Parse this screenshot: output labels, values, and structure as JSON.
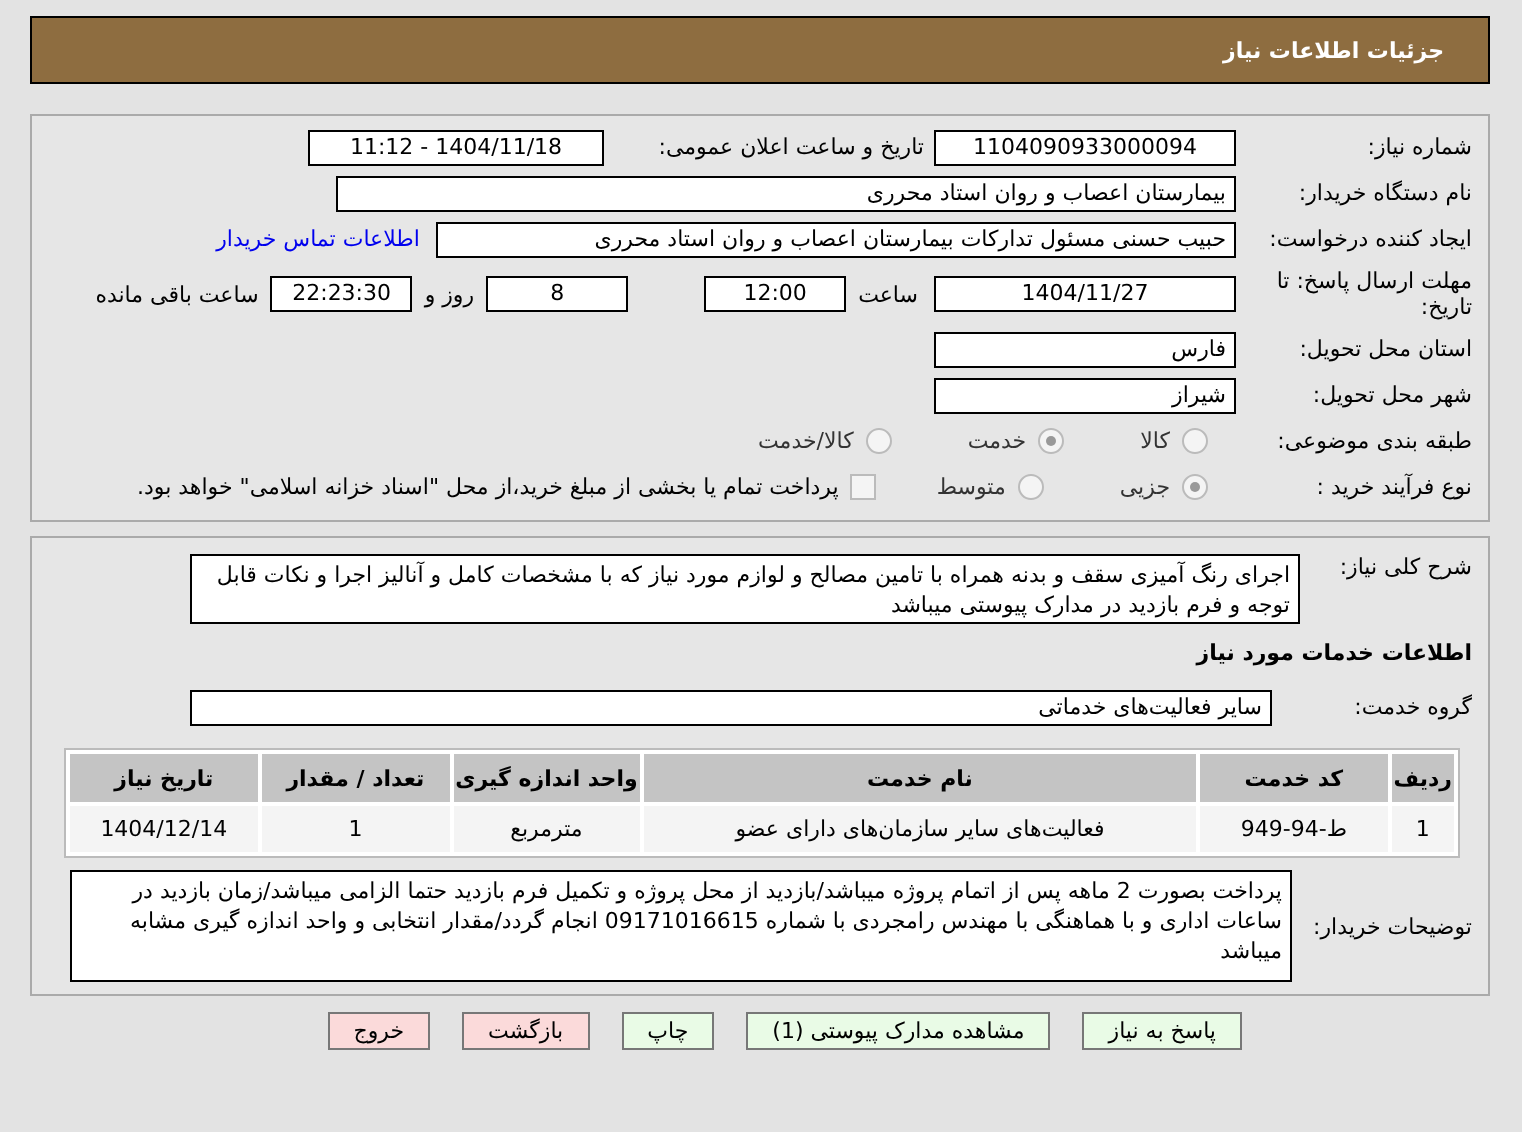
{
  "header": {
    "title": "جزئیات اطلاعات نیاز"
  },
  "need_info": {
    "need_number": {
      "label": "شماره نیاز:",
      "value": "1104090933000094"
    },
    "announce_datetime": {
      "label": "تاریخ و ساعت اعلان عمومی:",
      "value": "1404/11/18 - 11:12"
    },
    "buyer_org": {
      "label": "نام دستگاه خریدار:",
      "value": "بیمارستان اعصاب و روان استاد محرری"
    },
    "requester": {
      "label": "ایجاد کننده درخواست:",
      "value": "حبیب حسنی مسئول تدارکات بیمارستان اعصاب و روان استاد محرری"
    },
    "contact_link": "اطلاعات تماس خریدار",
    "deadline": {
      "label": "مهلت ارسال پاسخ: تا تاریخ:",
      "date": "1404/11/27",
      "time_label": "ساعت",
      "time": "12:00",
      "days": "8",
      "days_label": "روز و",
      "remaining": "22:23:30",
      "remaining_label": "ساعت باقی مانده"
    },
    "province": {
      "label": "استان محل تحویل:",
      "value": "فارس"
    },
    "city": {
      "label": "شهر محل تحویل:",
      "value": "شیراز"
    },
    "category": {
      "label": "طبقه بندی موضوعی:",
      "options": [
        {
          "label": "کالا",
          "selected": false
        },
        {
          "label": "خدمت",
          "selected": true
        },
        {
          "label": "کالا/خدمت",
          "selected": false
        }
      ]
    },
    "purchase_type": {
      "label": "نوع فرآیند خرید :",
      "options": [
        {
          "label": "جزیی",
          "selected": true
        },
        {
          "label": "متوسط",
          "selected": false
        }
      ],
      "treasury_payment": {
        "checked": false,
        "text": "پرداخت تمام یا بخشی از مبلغ خرید،از محل \"اسناد خزانه اسلامی\" خواهد بود."
      }
    }
  },
  "details": {
    "description": {
      "label": "شرح کلی نیاز:",
      "value": "اجرای رنگ آمیزی سقف و بدنه همراه با تامین مصالح و لوازم مورد نیاز که با مشخصات کامل و آنالیز اجرا و نکات قابل توجه و فرم بازدید در مدارک پیوستی میباشد"
    },
    "services_heading": "اطلاعات خدمات مورد نیاز",
    "service_group": {
      "label": "گروه خدمت:",
      "value": "سایر فعالیت‌های خدماتی"
    },
    "table": {
      "columns": [
        "ردیف",
        "کد خدمت",
        "نام خدمت",
        "واحد اندازه گیری",
        "تعداد / مقدار",
        "تاریخ نیاز"
      ],
      "rows": [
        [
          "1",
          "ط-94-949",
          "فعالیت‌های سایر سازمان‌های دارای عضو",
          "مترمربع",
          "1",
          "1404/12/14"
        ]
      ]
    },
    "buyer_notes": {
      "label": "توضیحات خریدار:",
      "value": "پرداخت بصورت 2 ماهه پس از اتمام پروژه میباشد/بازدید از محل پروژه و تکمیل فرم بازدید حتما الزامی میباشد/زمان بازدید در ساعات اداری و با هماهنگی با مهندس رامجردی با شماره 09171016615 انجام گردد/مقدار انتخابی و واحد اندازه گیری مشابه میباشد"
    }
  },
  "buttons": [
    {
      "label": "پاسخ به نیاز",
      "kind": "action"
    },
    {
      "label": "مشاهده مدارک پیوستی (1)",
      "kind": "action"
    },
    {
      "label": "چاپ",
      "kind": "action"
    },
    {
      "label": "بازگشت",
      "kind": "exit"
    },
    {
      "label": "خروج",
      "kind": "exit"
    }
  ]
}
